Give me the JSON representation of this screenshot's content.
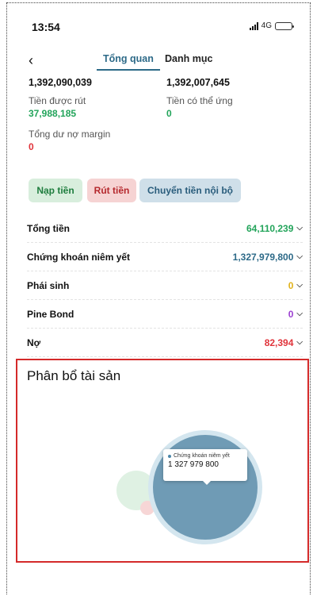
{
  "status_bar": {
    "time": "13:54",
    "network": "4G"
  },
  "nav": {
    "back_icon": "chevron-left-icon",
    "tabs": [
      "Tổng quan",
      "Danh mục"
    ],
    "active_tab": 0
  },
  "summary": {
    "left_amount": "1,392,090,039",
    "right_amount": "1,392,007,645",
    "withdrawable_label": "Tiền được rút",
    "withdrawable_value": "37,988,185",
    "advance_label": "Tiền có thể ứng",
    "advance_value": "0",
    "margin_label": "Tổng dư nợ margin",
    "margin_value": "0"
  },
  "actions": {
    "deposit": "Nạp tiền",
    "withdraw": "Rút tiền",
    "internal_transfer": "Chuyển tiền nội bộ"
  },
  "balances": [
    {
      "name": "Tổng tiền",
      "value": "64,110,239",
      "color": "#22a45a"
    },
    {
      "name": "Chứng khoán niêm yết",
      "value": "1,327,979,800",
      "color": "#2d6a88"
    },
    {
      "name": "Phái sinh",
      "value": "0",
      "color": "#e0b21a"
    },
    {
      "name": "Pine Bond",
      "value": "0",
      "color": "#9b3fd1"
    },
    {
      "name": "Nợ",
      "value": "82,394",
      "color": "#e0333a"
    }
  ],
  "allocation": {
    "title": "Phân bổ tài sản",
    "tooltip_label": "Chứng khoán niêm yết",
    "tooltip_value": "1 327 979 800"
  },
  "colors": {
    "accent": "#2d6a88",
    "highlight_border": "#d42a2a"
  }
}
